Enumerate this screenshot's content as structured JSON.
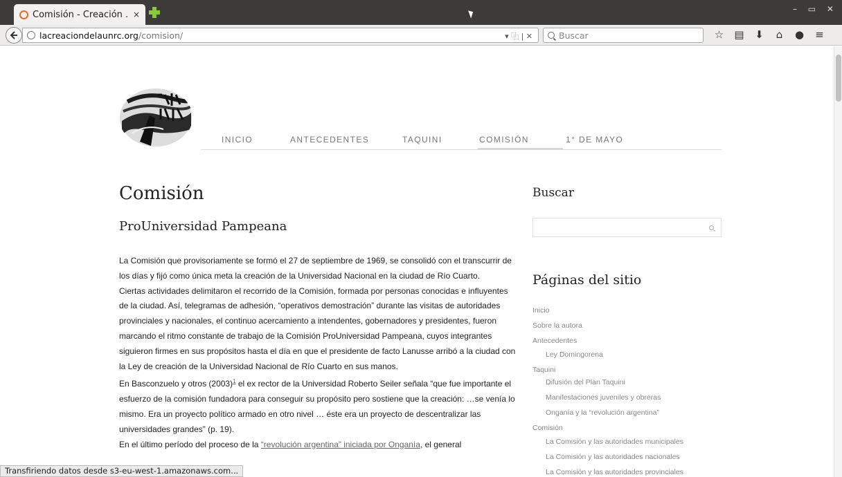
{
  "browser": {
    "tab_title": "Comisión - Creación ...",
    "tab_close": "×",
    "url_host": "lacreaciondelaunrc.org",
    "url_path": "/comision/",
    "url_actions": "▾ ⿻  |  ✕",
    "search_placeholder": "Buscar",
    "window_controls": "–  ▭  ✕",
    "status_text": "Transfiriendo datos desde s3-eu-west-1.amazonaws.com..."
  },
  "nav": {
    "items": [
      "INICIO",
      "ANTECEDENTES",
      "TAQUINI",
      "COMISIÓN",
      "1° DE MAYO"
    ],
    "active": "COMISIÓN"
  },
  "main": {
    "title": "Comisión",
    "subtitle": "ProUniversidad Pampeana",
    "p1": "La Comisión que provisoriamente se formó el 27 de septiembre de 1969, se consolidó con el transcurrir de los días y fijó como única meta la creación de la Universidad Nacional en la ciudad de Río Cuarto.",
    "p2": "Ciertas actividades delimitaron el recorrido de la Comisión, formada por personas conocidas e influyentes de la ciudad. Así, telegramas de adhesión, “operativos demostración” durante las visitas de autoridades provinciales y nacionales, el continuo acercamiento a intendentes, gobernadores y presidentes, fueron marcando el ritmo constante de trabajo de la Comisión ProUniversidad Pampeana, cuyos integrantes siguieron firmes en sus propósitos hasta el día en que el presidente de facto Lanusse arribó a la ciudad con la Ley de creación de la Universidad Nacional de Río Cuarto en sus manos.",
    "p3_before": "En Basconzuelo y otros (2003)",
    "p3_ref": "1",
    "p3_after": " el ex rector de la Universidad Roberto Seiler señala “que fue importante el esfuerzo de la comisión fundadora para conseguir su propósito pero sostiene que la creación: …se venía lo mismo. Era un proyecto político armado en otro nivel … éste era un proyecto de descentralizar las universidades grandes” (p. 19).",
    "p4_before": "En el último período del proceso de la ",
    "p4_link1": "“revolución argentina” iniciada por Onganía",
    "p4_after": ", el general"
  },
  "sidebar": {
    "search_heading": "Buscar",
    "pages_heading": "Páginas del sitio",
    "pages": [
      {
        "label": "Inicio",
        "level": 0
      },
      {
        "label": "Sobre la autora",
        "level": 0
      },
      {
        "label": "Antecedentes",
        "level": 0
      },
      {
        "label": "Ley Domingorena",
        "level": 1
      },
      {
        "label": "Taquini",
        "level": 0
      },
      {
        "label": "Difusión del Plan Taquini",
        "level": 1
      },
      {
        "label": "Manifestaciones juveniles y obreras",
        "level": 1
      },
      {
        "label": "Onganía y la “revolución argentina”",
        "level": 1
      },
      {
        "label": "Comisión",
        "level": 0
      },
      {
        "label": "La Comisión y las autoridades municipales",
        "level": 1
      },
      {
        "label": "La Comisión y las autoridades nacionales",
        "level": 1
      },
      {
        "label": "La Comisión y las autoridades provinciales",
        "level": 1
      }
    ]
  },
  "colors": {
    "chrome_dark": "#3c3b37",
    "tab_bg": "#f2f1f0",
    "favicon": "#e96a2d",
    "newtab": "#8cc63f",
    "link": "#666666"
  }
}
